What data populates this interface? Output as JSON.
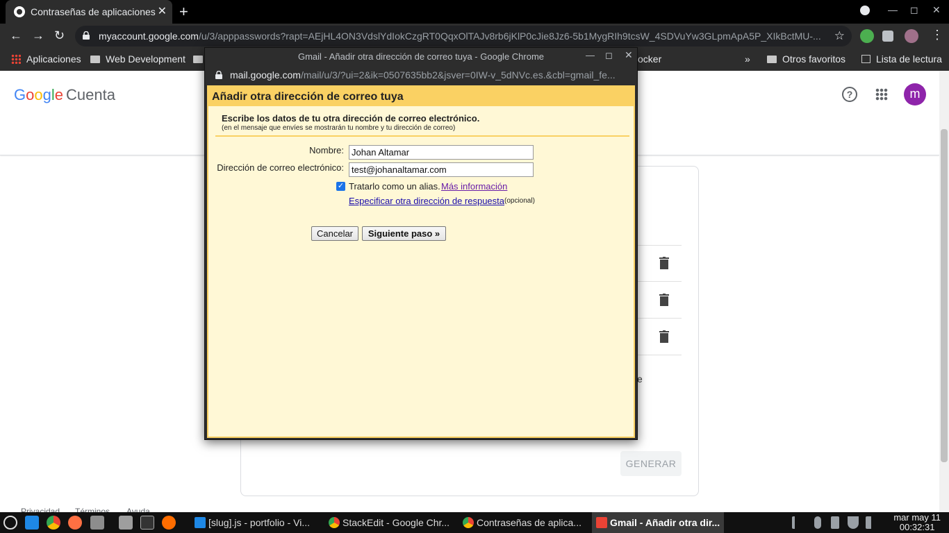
{
  "browser": {
    "tab_title": "Contraseñas de aplicaciones",
    "url_host": "myaccount.google.com",
    "url_path": "/u/3/apppasswords?rapt=AEjHL4ON3VdslYdIokCzgRT0QqxOlTAJv8rb6jKlP0cJie8Jz6-5b1MygRIh9tcsW_4SDVuYw3GLpmApA5P_XIkBctMU-...",
    "bookmarks": [
      "Aplicaciones",
      "Web Development",
      "ocker",
      "Otros favoritos",
      "Lista de lectura"
    ],
    "bookmarks_overflow": "»"
  },
  "account_page": {
    "logo_parts": [
      "G",
      "o",
      "o",
      "g",
      "l",
      "e"
    ],
    "section": "Cuenta",
    "avatar_letter": "m",
    "generate_button": "GENERAR",
    "footer_links": [
      "Privacidad",
      "Términos",
      "Ayuda"
    ],
    "partial_text": "e"
  },
  "popup": {
    "window_title": "Gmail - Añadir otra dirección de correo tuya - Google Chrome",
    "url_host": "mail.google.com",
    "url_path": "/mail/u/3/?ui=2&ik=0507635bb2&jsver=0IW-v_5dNVc.es.&cbl=gmail_fe...",
    "dialog_title": "Añadir otra dirección de correo tuya",
    "instructions": "Escribe los datos de tu otra dirección de correo electrónico.",
    "instructions_sub": "(en el mensaje que envíes se mostrarán tu nombre y tu dirección de correo)",
    "name_label": "Nombre:",
    "name_value": "Johan Altamar",
    "email_label": "Dirección de correo electrónico:",
    "email_value": "test@johanaltamar.com",
    "alias_checked": true,
    "alias_label": "Tratarlo como un alias.",
    "more_info_link": "Más información",
    "reply_to_link": "Especificar otra dirección de respuesta",
    "optional_note": "(opcional)",
    "cancel_button": "Cancelar",
    "next_button": "Siguiente paso »"
  },
  "taskbar": {
    "tasks": [
      "[slug].js - portfolio - Vi...",
      "StackEdit - Google Chr...",
      "Contraseñas de aplica...",
      "Gmail - Añadir otra dir..."
    ],
    "date": "mar may 11",
    "time": "00:32:31"
  },
  "colors": {
    "dialog_background": "#fff8d6",
    "dialog_border": "#fad163",
    "avatar": "#8e24aa",
    "link": "#1a0dab"
  }
}
